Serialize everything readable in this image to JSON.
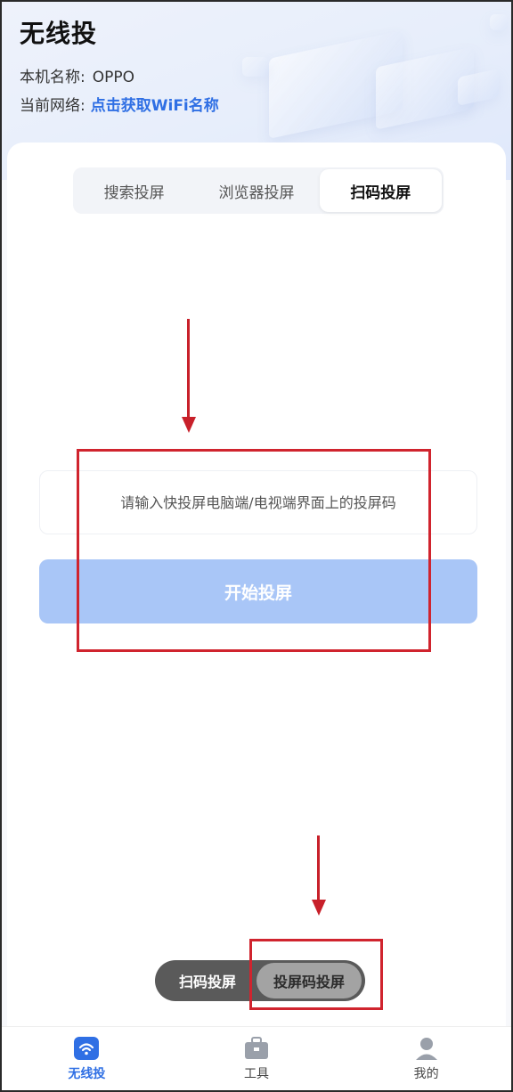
{
  "header": {
    "title": "无线投",
    "device_label": "本机名称:",
    "device_name": "OPPO",
    "network_label": "当前网络:",
    "network_link": "点击获取WiFi名称"
  },
  "tabs": [
    {
      "label": "搜索投屏",
      "active": false
    },
    {
      "label": "浏览器投屏",
      "active": false
    },
    {
      "label": "扫码投屏",
      "active": true
    }
  ],
  "code_form": {
    "placeholder": "请输入快投屏电脑端/电视端界面上的投屏码",
    "value": "",
    "button_label": "开始投屏"
  },
  "mode_switch": {
    "left_label": "扫码投屏",
    "right_label": "投屏码投屏",
    "selected": "投屏码投屏"
  },
  "bottom_nav": [
    {
      "label": "无线投",
      "icon": "cast-icon",
      "active": true
    },
    {
      "label": "工具",
      "icon": "toolbox-icon",
      "active": false
    },
    {
      "label": "我的",
      "icon": "profile-icon",
      "active": false
    }
  ],
  "colors": {
    "accent": "#2f6fe4",
    "button_disabled": "#a9c6f7",
    "annotation_red": "#d0242e"
  }
}
